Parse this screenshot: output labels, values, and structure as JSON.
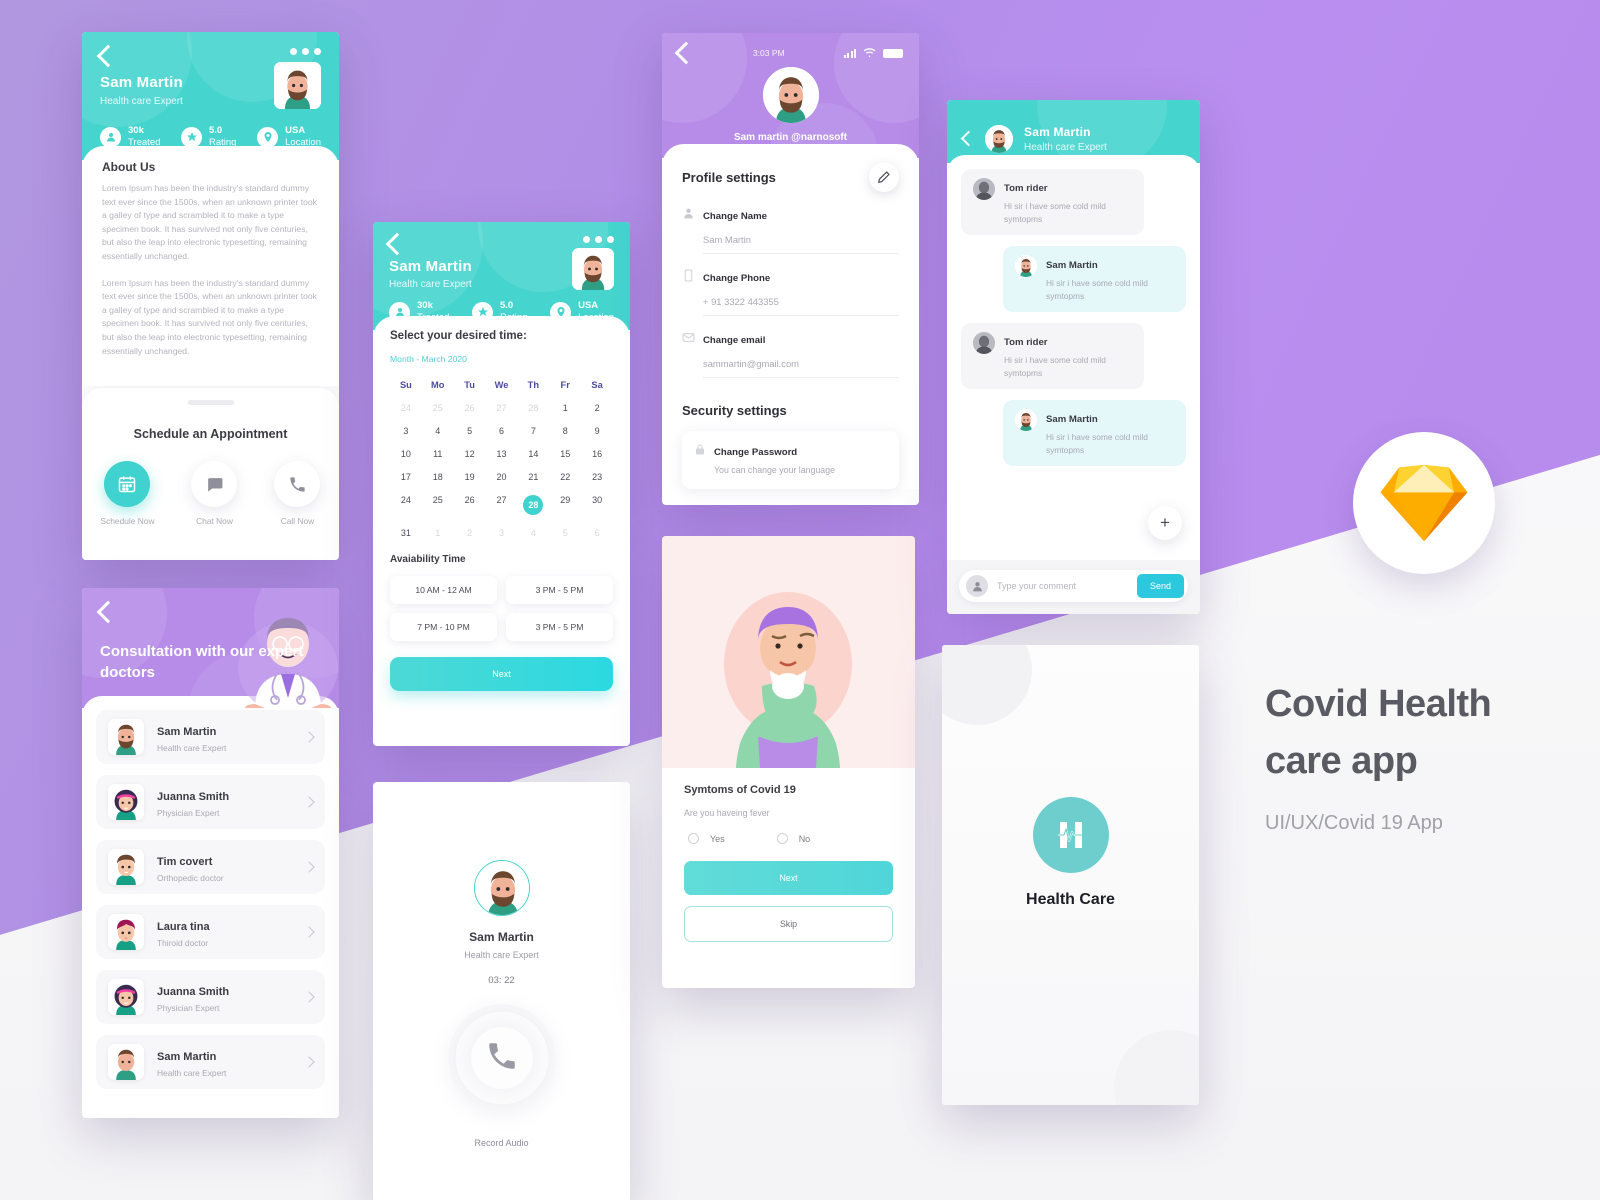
{
  "background": {
    "purple": "#b48ee8",
    "teal": "#46d4cf",
    "white": "#ffffff"
  },
  "branding": {
    "title_line1": "Covid Health",
    "title_line2": "care app",
    "subtitle": "UI/UX/Covid 19 App",
    "tool_icon": "sketch-diamond-icon"
  },
  "doctor_profile": {
    "back_icon": "back-chevron-icon",
    "more_icon": "more-options-icon",
    "name": "Sam Martin",
    "role": "Health care Expert",
    "stats": [
      {
        "icon": "person-icon",
        "value": "30k",
        "label": "Treated"
      },
      {
        "icon": "star-icon",
        "value": "5.0",
        "label": "Rating"
      },
      {
        "icon": "location-pin-icon",
        "value": "USA",
        "label": "Location"
      }
    ],
    "about_title": "About  Us",
    "about_p1": "Lorem Ipsum has been the industry's standard dummy text ever since the 1500s, when an unknown printer took a galley of type and scrambled it to make a type specimen book. It has survived not only five centuries, but also the leap into electronic typesetting, remaining essentially unchanged.",
    "about_p2": "Lorem Ipsum has been the industry's standard dummy text ever since the 1500s, when an unknown printer took a galley of type and scrambled it to make a type specimen book. It has survived not only five centuries, but also the leap into electronic typesetting, remaining essentially unchanged.",
    "schedule_title": "Schedule  an Appointment",
    "actions": [
      {
        "icon": "calendar-icon",
        "label": "Schedule Now",
        "active": true
      },
      {
        "icon": "chat-bubble-icon",
        "label": "Chat Now",
        "active": false
      },
      {
        "icon": "phone-icon",
        "label": "Call Now",
        "active": false
      }
    ]
  },
  "consultation": {
    "back_icon": "back-chevron-icon",
    "title": "Consultation with our expert doctors",
    "doctors": [
      {
        "name": "Sam Martin",
        "role": "Health care Expert"
      },
      {
        "name": "Juanna Smith",
        "role": "Physician Expert"
      },
      {
        "name": "Tim covert",
        "role": "Orthopedic doctor"
      },
      {
        "name": "Laura tina",
        "role": "Thiroid doctor"
      },
      {
        "name": "Juanna Smith",
        "role": "Physician Expert"
      },
      {
        "name": "Sam Martin",
        "role": "Health care Expert"
      }
    ]
  },
  "calendar": {
    "name": "Sam Martin",
    "role": "Health care Expert",
    "stats": [
      {
        "value": "30k",
        "label": "Treated"
      },
      {
        "value": "5.0",
        "label": "Rating"
      },
      {
        "value": "USA",
        "label": "Location"
      }
    ],
    "heading": "Select your desired time:",
    "month_label": "Month - March 2020",
    "weekdays": [
      "Su",
      "Mo",
      "Tu",
      "We",
      "Th",
      "Fr",
      "Sa"
    ],
    "days": [
      {
        "d": "24",
        "mut": true
      },
      {
        "d": "25",
        "mut": true
      },
      {
        "d": "26",
        "mut": true
      },
      {
        "d": "27",
        "mut": true
      },
      {
        "d": "28",
        "mut": true
      },
      {
        "d": "1"
      },
      {
        "d": "2"
      },
      {
        "d": "3"
      },
      {
        "d": "4"
      },
      {
        "d": "5"
      },
      {
        "d": "6"
      },
      {
        "d": "7"
      },
      {
        "d": "8"
      },
      {
        "d": "9"
      },
      {
        "d": "10"
      },
      {
        "d": "11"
      },
      {
        "d": "12"
      },
      {
        "d": "13"
      },
      {
        "d": "14"
      },
      {
        "d": "15"
      },
      {
        "d": "16"
      },
      {
        "d": "17"
      },
      {
        "d": "18"
      },
      {
        "d": "19"
      },
      {
        "d": "20"
      },
      {
        "d": "21"
      },
      {
        "d": "22"
      },
      {
        "d": "23"
      },
      {
        "d": "24"
      },
      {
        "d": "25"
      },
      {
        "d": "26"
      },
      {
        "d": "27"
      },
      {
        "d": "28",
        "sel": true
      },
      {
        "d": "29"
      },
      {
        "d": "30"
      },
      {
        "d": "31"
      },
      {
        "d": "1",
        "mut": true
      },
      {
        "d": "2",
        "mut": true
      },
      {
        "d": "3",
        "mut": true
      },
      {
        "d": "4",
        "mut": true
      },
      {
        "d": "5",
        "mut": true
      },
      {
        "d": "6",
        "mut": true
      }
    ],
    "selected_day": "28",
    "availability_title": "Avaiability Time",
    "slots": [
      "10 AM - 12 AM",
      "3 PM - 5 PM",
      "7 PM - 10 PM",
      "3 PM - 5 PM"
    ],
    "next_label": "Next"
  },
  "record_audio": {
    "name": "Sam Martin",
    "role": "Health care Expert",
    "timer": "03: 22",
    "call_icon": "phone-icon",
    "label": "Record Audio"
  },
  "profile_settings": {
    "status_time": "3:03 PM",
    "handle": "Sam martin @narnosoft",
    "title": "Profile settings",
    "edit_icon": "pencil-icon",
    "fields": [
      {
        "icon": "person-icon",
        "label": "Change Name",
        "value": "Sam Martin"
      },
      {
        "icon": "phone-box-icon",
        "label": "Change Phone",
        "value": "+ 91 3322 443355"
      },
      {
        "icon": "envelope-icon",
        "label": "Change email",
        "value": "sammartin@gmail.com"
      }
    ],
    "security_title": "Security settings",
    "password": {
      "icon": "lock-icon",
      "label": "Change Password",
      "sub": "You can change your language"
    }
  },
  "symptoms": {
    "title": "Symtoms of Covid 19",
    "question": "Are you haveing fever",
    "options": [
      "Yes",
      "No"
    ],
    "next_label": "Next",
    "skip_label": "Skip"
  },
  "chat": {
    "name": "Sam Martin",
    "role": "Health care Expert",
    "messages": [
      {
        "side": "left",
        "name": "Tom rider",
        "text": "Hi sir i have some cold mild symtopms"
      },
      {
        "side": "right",
        "name": "Sam Martin",
        "text": "Hi sir i have some cold mild symtopms"
      },
      {
        "side": "left",
        "name": "Tom rider",
        "text": "Hi sir i have some cold mild symtopms"
      },
      {
        "side": "right",
        "name": "Sam Martin",
        "text": "Hi sir i have some cold mild symtopms"
      }
    ],
    "add_label": "+",
    "composer_placeholder": "Type your comment",
    "send_label": "Send"
  },
  "splash": {
    "app_name": "Health Care",
    "logo_icon": "heartbeat-h-logo-icon"
  }
}
